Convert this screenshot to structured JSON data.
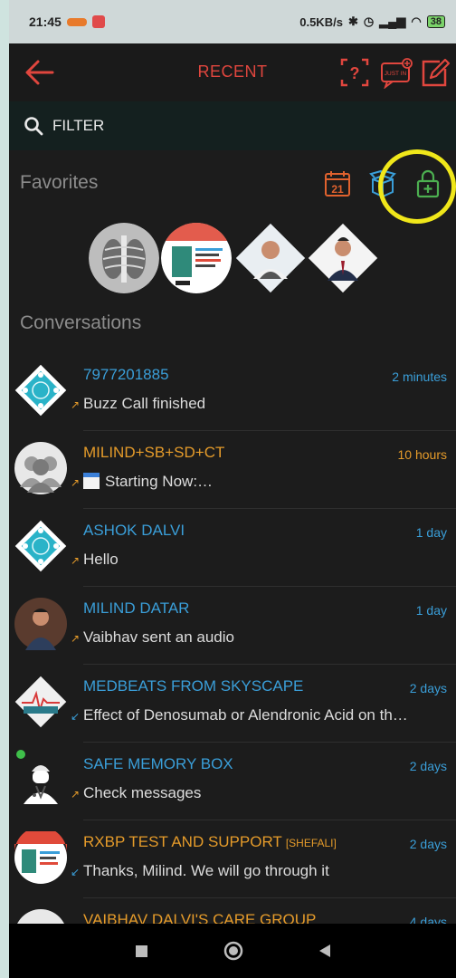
{
  "status_bar": {
    "time": "21:45",
    "speed": "0.5KB/s",
    "battery": "38"
  },
  "header": {
    "title": "RECENT",
    "just_in_label": "JUST IN"
  },
  "filter": {
    "placeholder": "FILTER"
  },
  "favorites": {
    "title": "Favorites",
    "calendar_day": "21"
  },
  "conversations": {
    "title": "Conversations",
    "items": [
      {
        "name": "7977201885",
        "time": "2 minutes",
        "message": "Buzz Call finished"
      },
      {
        "name": "MILIND+SB+SD+CT",
        "time": "10 hours",
        "message": "Starting Now:…"
      },
      {
        "name": "ASHOK DALVI",
        "time": "1 day",
        "message": "Hello"
      },
      {
        "name": "MILIND DATAR",
        "time": "1 day",
        "message": "Vaibhav  sent an audio"
      },
      {
        "name": "MEDBEATS FROM SKYSCAPE",
        "time": "2 days",
        "message": "Effect of Denosumab or Alendronic Acid on th…"
      },
      {
        "name": "SAFE MEMORY BOX",
        "time": "2 days",
        "message": "Check messages"
      },
      {
        "name": "RXBP TEST AND SUPPORT",
        "tag": "[SHEFALI]",
        "time": "2 days",
        "message": "Thanks, Milind. We will go through it"
      },
      {
        "name": "VAIBHAV DALVI'S CARE GROUP",
        "time": "4 days"
      }
    ]
  },
  "colors": {
    "accent_red": "#e0463e",
    "name_blue": "#3a9ed8",
    "orange": "#e59b2a",
    "green": "#4caf50",
    "highlight": "#f0e71a"
  }
}
